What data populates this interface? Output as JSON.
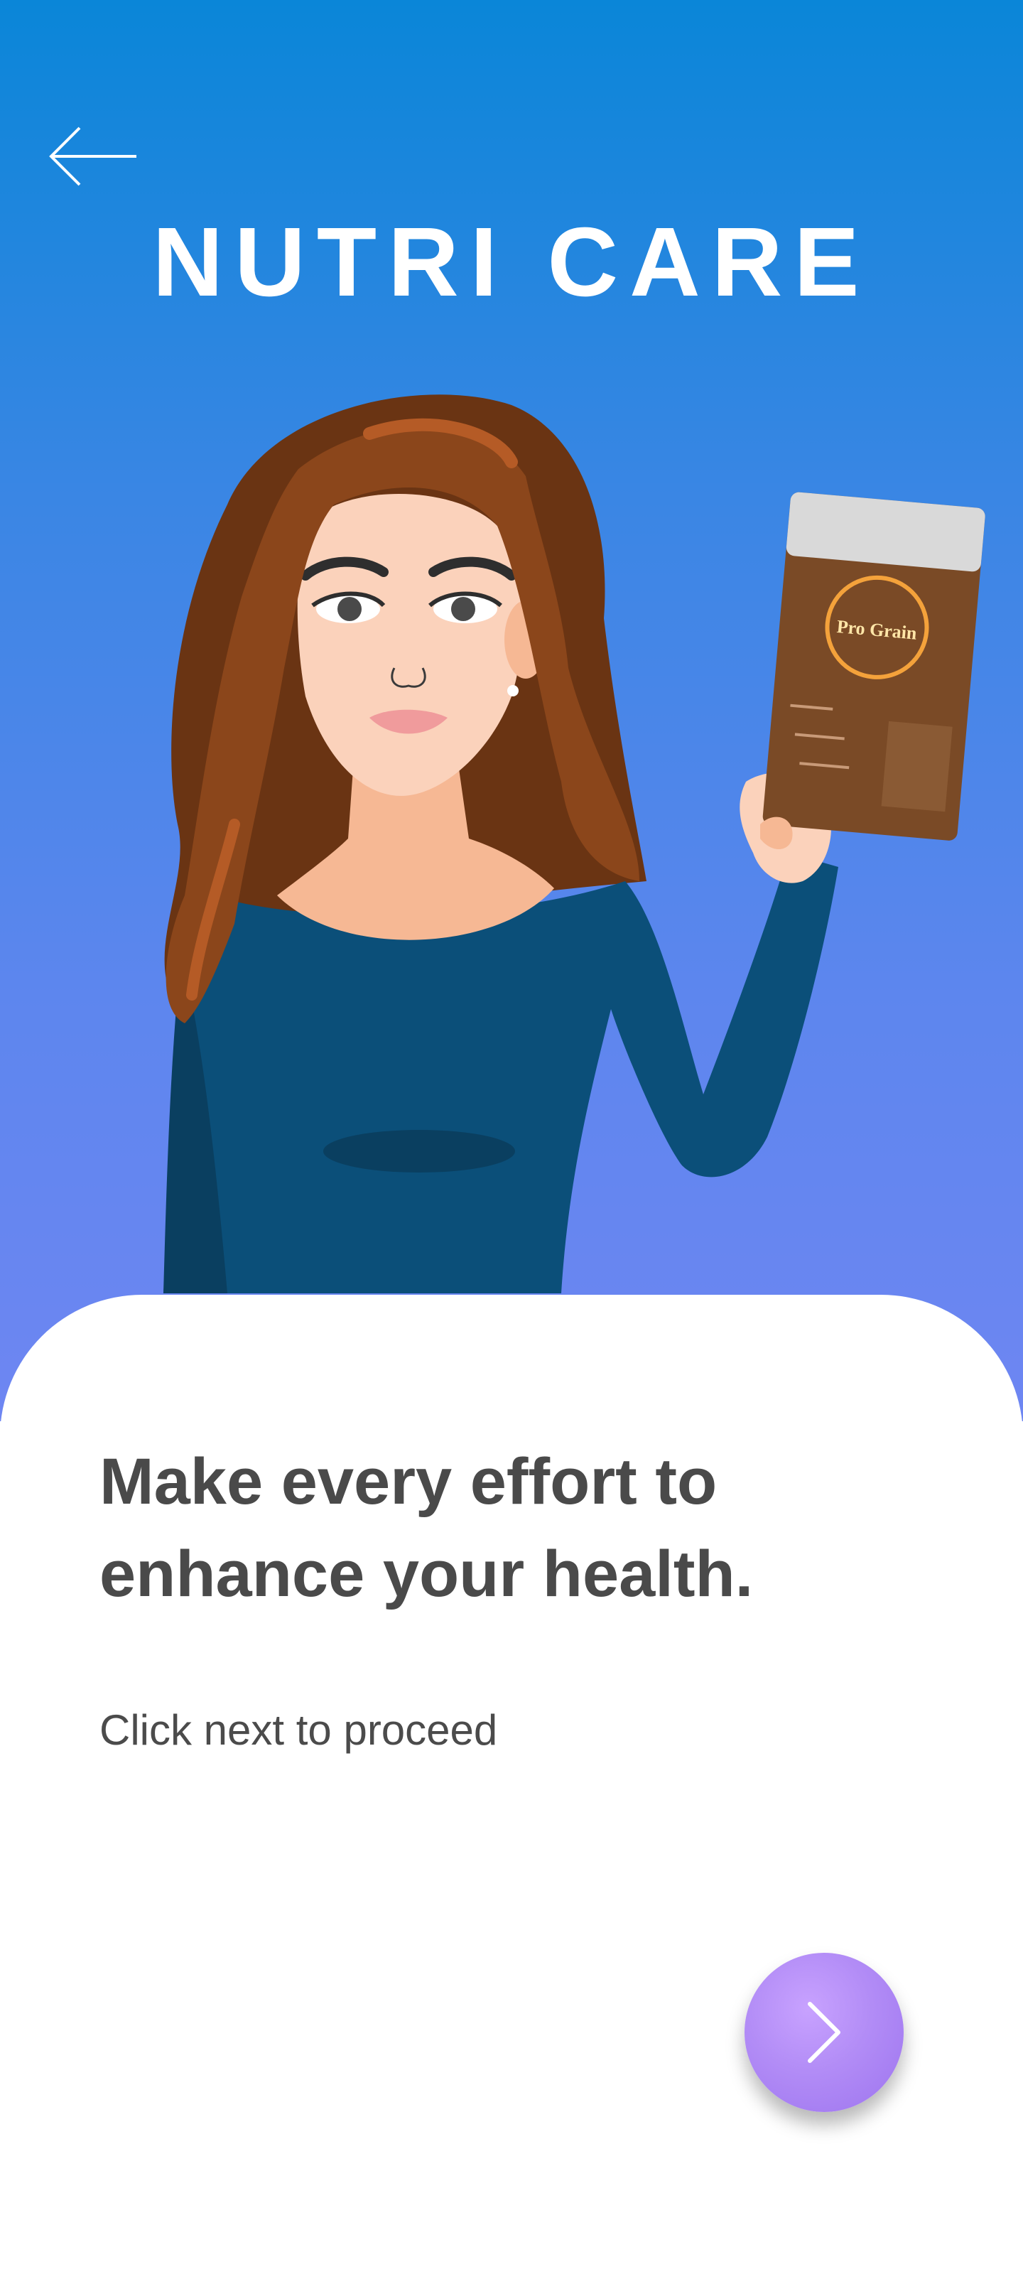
{
  "app": {
    "title": "NUTRI CARE"
  },
  "header": {
    "back_icon": "arrow-left-icon"
  },
  "hero": {
    "illustration": "woman-holding-product-bag",
    "product_brand": "Pro Grain"
  },
  "content": {
    "headline_line1": "Make every effort to",
    "headline_line2": "enhance your health.",
    "subtitle": "Click next to proceed"
  },
  "next_button": {
    "icon": "chevron-right-icon"
  },
  "colors": {
    "gradient_top": "#0a86d8",
    "gradient_bottom": "#6e86f2",
    "text_dark": "#4a4a4a",
    "button": "#b28cf6"
  }
}
